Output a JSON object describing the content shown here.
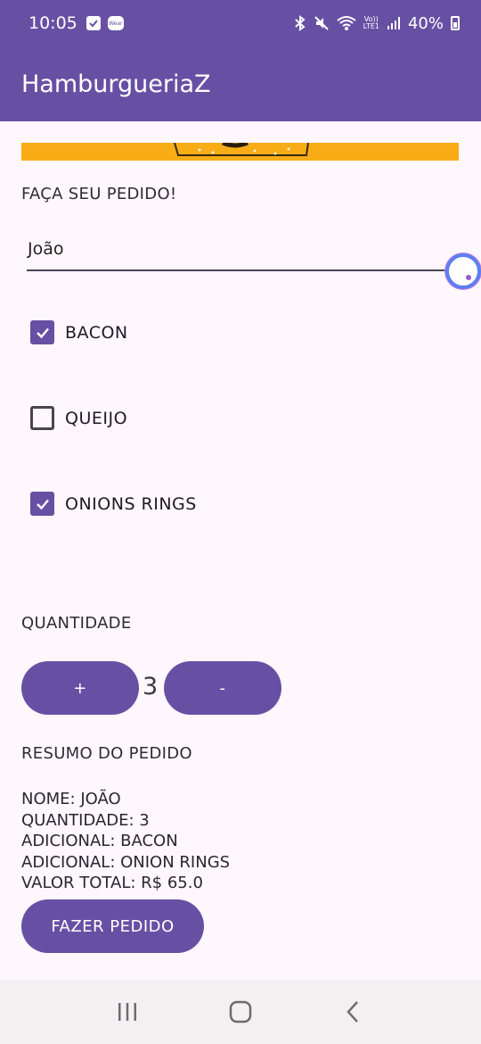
{
  "status_bar": {
    "time": "10:05",
    "battery": "40%",
    "lte_top": "Vo))",
    "lte_bottom": "LTE1",
    "wear_label": "Wear"
  },
  "app_bar": {
    "title": "HamburgueriaZ"
  },
  "order": {
    "heading": "FAÇA SEU PEDIDO!",
    "name_value": "João"
  },
  "toppings": [
    {
      "label": "BACON",
      "checked": true
    },
    {
      "label": "QUEIJO",
      "checked": false
    },
    {
      "label": "ONIONS RINGS",
      "checked": true
    }
  ],
  "quantity": {
    "heading": "QUANTIDADE",
    "increment_label": "+",
    "value": "3",
    "decrement_label": "-"
  },
  "summary": {
    "heading": "RESUMO DO PEDIDO",
    "lines": [
      "NOME: JOÃO",
      "QUANTIDADE: 3",
      "ADICIONAL: BACON",
      "ADICIONAL: ONION RINGS",
      "VALOR TOTAL: R$ 65.0"
    ]
  },
  "submit_label": "FAZER PEDIDO",
  "colors": {
    "primary": "#6750a4",
    "background": "#fef7fd",
    "banner": "#f8ad17"
  },
  "icons": {
    "nav_recent": "recent-apps-icon",
    "nav_home": "home-icon",
    "nav_back": "back-icon"
  }
}
